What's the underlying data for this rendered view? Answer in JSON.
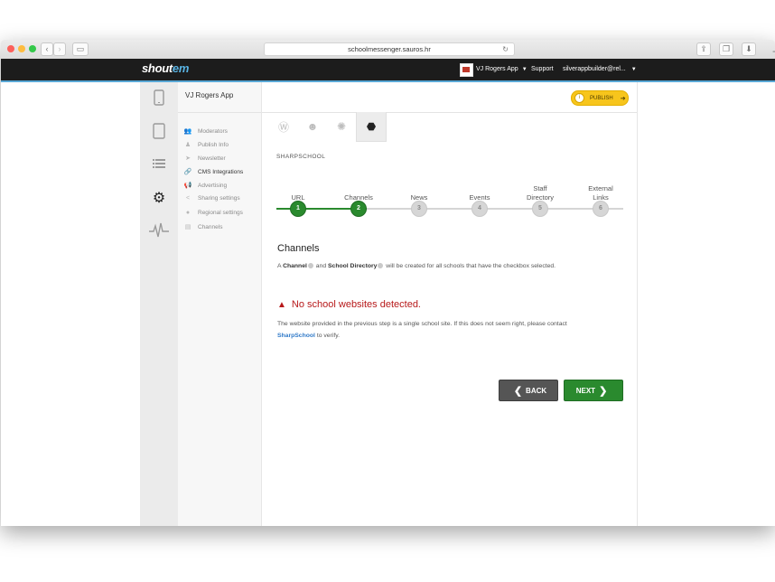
{
  "browser": {
    "url": "schoolmessenger.sauros.hr"
  },
  "appbar": {
    "logo_main": "shout",
    "logo_accent": "em",
    "app_name": "VJ Rogers App",
    "support": "Support",
    "user": "silverappbuilder@rel..."
  },
  "sidebar": {
    "title": "VJ Rogers App",
    "items": [
      {
        "label": "Moderators",
        "icon": "users-icon"
      },
      {
        "label": "Publish Info",
        "icon": "person-icon"
      },
      {
        "label": "Newsletter",
        "icon": "send-icon"
      },
      {
        "label": "CMS Integrations",
        "icon": "link-icon"
      },
      {
        "label": "Advertising",
        "icon": "megaphone-icon"
      },
      {
        "label": "Sharing settings",
        "icon": "share-icon"
      },
      {
        "label": "Regional settings",
        "icon": "globe-icon"
      },
      {
        "label": "Channels",
        "icon": "list-icon"
      }
    ],
    "active_index": 3
  },
  "main": {
    "publish_label": "PUBLISH",
    "section_label": "SHARPSCHOOL",
    "steps": [
      {
        "label": "URL",
        "num": "1",
        "done": true
      },
      {
        "label": "Channels",
        "num": "2",
        "done": true
      },
      {
        "label": "News",
        "num": "3",
        "done": false
      },
      {
        "label": "Events",
        "num": "4",
        "done": false
      },
      {
        "label": "Staff Directory",
        "num": "5",
        "done": false
      },
      {
        "label": "External Links",
        "num": "6",
        "done": false
      }
    ],
    "heading": "Channels",
    "desc_prefix": "A",
    "desc_channel": "Channel",
    "desc_and": "and",
    "desc_directory": "School Directory",
    "desc_suffix": "will be created for all schools that have the checkbox selected.",
    "warning_title": "No school websites detected.",
    "warning_text_1": "The website provided in the previous step is a single school site. If this does not seem right, please contact",
    "warning_link": "SharpSchool",
    "warning_text_2": "to verify.",
    "back_label": "BACK",
    "next_label": "NEXT"
  },
  "colors": {
    "accent_green": "#2a8a2e",
    "warning_red": "#b7191a",
    "publish_yellow": "#f7c51c",
    "link_blue": "#2f79c8"
  }
}
